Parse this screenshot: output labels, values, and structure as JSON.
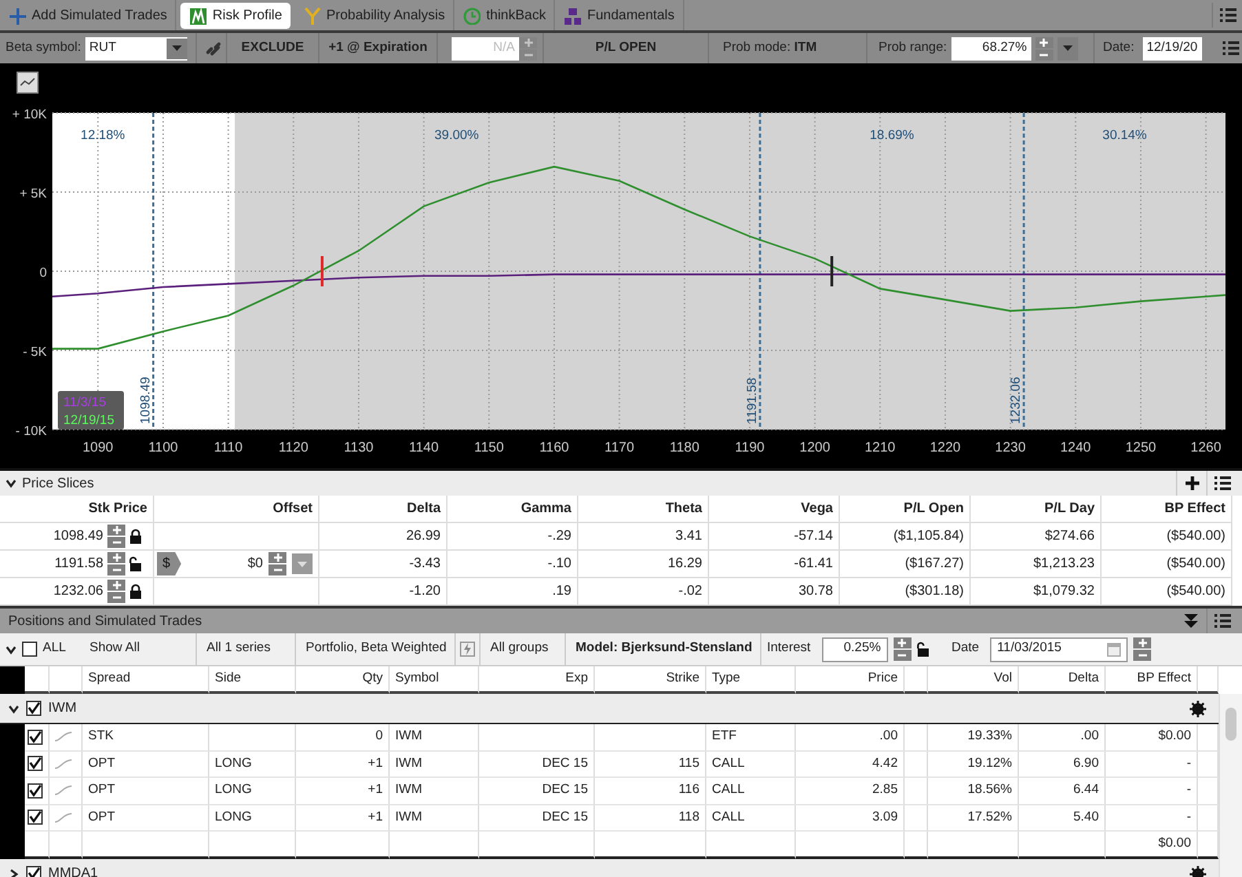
{
  "tabs": [
    {
      "label": "Add Simulated Trades",
      "kind": "add",
      "selected": false
    },
    {
      "label": "Risk Profile",
      "kind": "risk",
      "selected": true
    },
    {
      "label": "Probability Analysis",
      "kind": "probability",
      "selected": false
    },
    {
      "label": "thinkBack",
      "kind": "history",
      "selected": false
    },
    {
      "label": "Fundamentals",
      "kind": "fundamentals",
      "selected": false
    }
  ],
  "toolbar": {
    "beta_label": "Beta symbol:",
    "beta_symbol": "RUT",
    "exclude": "EXCLUDE",
    "step": "+1 @ Expiration",
    "offset_field": {
      "value": "N/A",
      "disabled": true
    },
    "pl_mode": "P/L OPEN",
    "prob_mode_label": "Prob mode:",
    "prob_mode": "ITM",
    "prob_range_label": "Prob range:",
    "prob_range": "68.27%",
    "date_label": "Date:",
    "date": "12/19/20"
  },
  "chart": {
    "chart_data": {
      "type": "line",
      "grid": true,
      "xlim": [
        1083,
        1263
      ],
      "ylim": [
        -10000,
        10000
      ],
      "x": [
        1083,
        1090,
        1100,
        1110,
        1120,
        1130,
        1140,
        1150,
        1160,
        1170,
        1180,
        1190,
        1200,
        1210,
        1220,
        1230,
        1240,
        1250,
        1260,
        1263
      ],
      "series": [
        {
          "name": "11/3/15",
          "color": "#5b1f7c",
          "values": [
            -1600,
            -1400,
            -1000,
            -800,
            -600,
            -400,
            -300,
            -300,
            -200,
            -200,
            -200,
            -200,
            -200,
            -200,
            -200,
            -200,
            -200,
            -200,
            -200,
            -200
          ]
        },
        {
          "name": "12/19/15",
          "color": "#2f8f2f",
          "values": [
            -4900,
            -4900,
            -3800,
            -2800,
            -900,
            1300,
            4100,
            5600,
            6600,
            5700,
            3900,
            2200,
            800,
            -1100,
            -1800,
            -2500,
            -2300,
            -1900,
            -1600,
            -1500
          ]
        }
      ],
      "xticks": [
        1090,
        1100,
        1110,
        1120,
        1130,
        1140,
        1150,
        1160,
        1170,
        1180,
        1190,
        1200,
        1210,
        1220,
        1230,
        1240,
        1250,
        1260
      ],
      "yticks": [
        {
          "value": 10000,
          "label": "+ 10K"
        },
        {
          "value": 5000,
          "label": "+ 5K"
        },
        {
          "value": 0,
          "label": "0"
        },
        {
          "value": -5000,
          "label": "- 5K"
        },
        {
          "value": -10000,
          "label": "- 10K"
        }
      ],
      "bands": [
        {
          "axis": "x",
          "from": 1111,
          "to": 1263
        }
      ],
      "ref_lines": [
        {
          "axis": "x",
          "value": 1098.49,
          "label": "1098.49"
        },
        {
          "axis": "x",
          "value": 1191.58,
          "label": "1191.58"
        },
        {
          "axis": "x",
          "value": 1232.06,
          "label": "1232.06"
        }
      ],
      "annotations": [
        "12.18%",
        "39.00%",
        "18.69%",
        "30.14%"
      ]
    },
    "markers": [
      {
        "color": "#e02828"
      },
      {
        "color": "#222222"
      }
    ]
  },
  "price_slices": {
    "title": "Price Slices",
    "expanded": true,
    "columns": [
      "Stk Price",
      "Offset",
      "Delta",
      "Gamma",
      "Theta",
      "Vega",
      "P/L Open",
      "P/L Day",
      "BP Effect"
    ],
    "rows": [
      {
        "stk_price": "1098.49",
        "locked": true,
        "values": [
          "26.99",
          "-.29",
          "3.41",
          "-57.14",
          "($1,105.84)",
          "$274.66",
          "($540.00)"
        ]
      },
      {
        "stk_price": "1191.58",
        "locked": false,
        "offset_unit": "$",
        "offset": "$0",
        "values": [
          "-3.43",
          "-.10",
          "16.29",
          "-61.41",
          "($167.27)",
          "$1,213.23",
          "($540.00)"
        ]
      },
      {
        "stk_price": "1232.06",
        "locked": true,
        "values": [
          "-1.20",
          ".19",
          "-.02",
          "30.78",
          "($301.18)",
          "$1,079.32",
          "($540.00)"
        ]
      }
    ]
  },
  "positions": {
    "title": "Positions and Simulated Trades",
    "filters": {
      "all_label": "ALL",
      "all_checked": false,
      "show": "Show All",
      "series": "All 1 series",
      "portfolio": "Portfolio, Beta Weighted",
      "groups": "All groups",
      "model": "Model: Bjerksund-Stensland",
      "interest_label": "Interest",
      "interest": "0.25%",
      "interest_locked": false,
      "date_label": "Date",
      "date": "11/03/2015"
    },
    "columns": [
      "Spread",
      "Side",
      "Qty",
      "Symbol",
      "Exp",
      "Strike",
      "Type",
      "Price",
      "Vol",
      "Delta",
      "BP Effect"
    ],
    "groups": [
      {
        "name": "IWM",
        "expanded": true,
        "checked": true,
        "total_bp_effect": "$0.00",
        "rows": [
          {
            "checked": true,
            "spread": "STK",
            "qty": "0",
            "symbol": "IWM",
            "type": "ETF",
            "price": ".00",
            "vol": "19.33%",
            "delta": ".00",
            "bp_effect": "$0.00"
          },
          {
            "checked": true,
            "spread": "OPT",
            "side": "LONG",
            "qty": "+1",
            "symbol": "IWM",
            "exp": "DEC 15",
            "strike": "115",
            "type": "CALL",
            "price": "4.42",
            "vol": "19.12%",
            "delta": "6.90",
            "bp_effect": "-"
          },
          {
            "checked": true,
            "spread": "OPT",
            "side": "LONG",
            "qty": "+1",
            "symbol": "IWM",
            "exp": "DEC 15",
            "strike": "116",
            "type": "CALL",
            "price": "2.85",
            "vol": "18.56%",
            "delta": "6.44",
            "bp_effect": "-"
          },
          {
            "checked": true,
            "spread": "OPT",
            "side": "LONG",
            "qty": "+1",
            "symbol": "IWM",
            "exp": "DEC 15",
            "strike": "118",
            "type": "CALL",
            "price": "3.09",
            "vol": "17.52%",
            "delta": "5.40",
            "bp_effect": "-"
          }
        ]
      },
      {
        "name": "MMDA1",
        "expanded": false,
        "checked": true
      }
    ]
  }
}
